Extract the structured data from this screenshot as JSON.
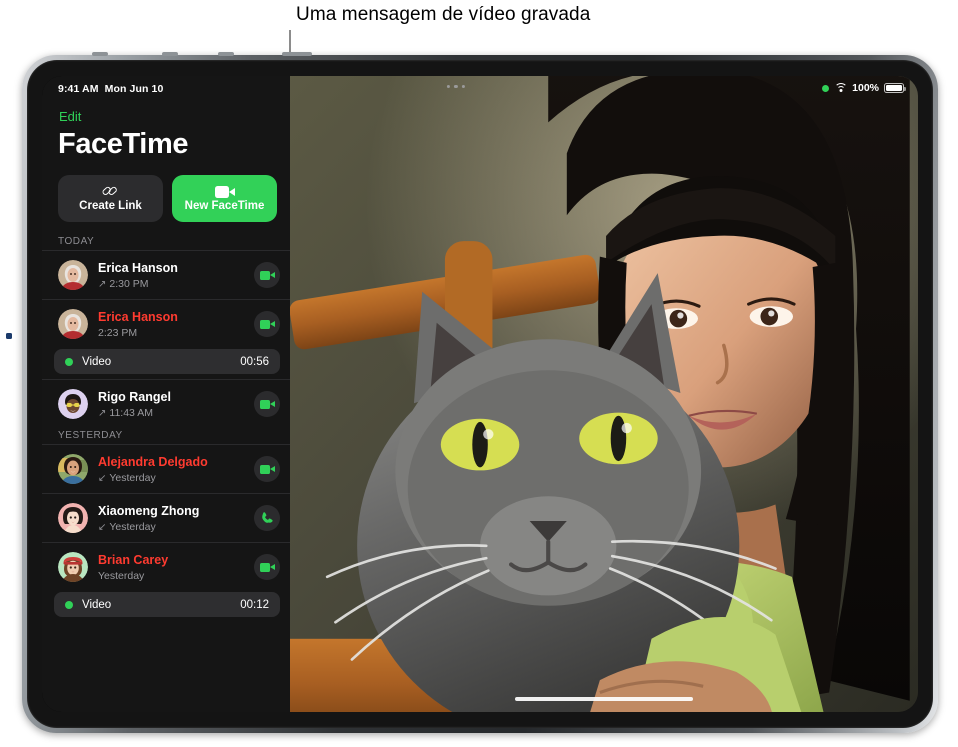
{
  "callout": {
    "text": "Uma mensagem de vídeo gravada"
  },
  "status_bar": {
    "time": "9:41 AM",
    "date": "Mon Jun 10",
    "battery_percent": "100%",
    "recording_dot": "green-dot",
    "wifi_icon": "wifi-icon",
    "battery_icon": "battery-icon"
  },
  "sidebar": {
    "edit_label": "Edit",
    "title": "FaceTime",
    "actions": [
      {
        "label": "Create Link",
        "icon": "link-icon",
        "style": "grey"
      },
      {
        "label": "New FaceTime",
        "icon": "video-camera-icon",
        "style": "green"
      }
    ],
    "sections": [
      {
        "header": "TODAY",
        "rows": [
          {
            "name": "Erica Hanson",
            "time": "2:30 PM",
            "direction": "outgoing",
            "arrow": "↗",
            "missed": false,
            "call_type": "video",
            "avatar": "photo-woman-white-hair",
            "message": null
          },
          {
            "name": "Erica Hanson",
            "time": "2:23 PM",
            "direction": "none",
            "arrow": "",
            "missed": true,
            "call_type": "video",
            "avatar": "photo-woman-white-hair",
            "message": {
              "label": "Video",
              "duration": "00:56"
            }
          },
          {
            "name": "Rigo Rangel",
            "time": "11:43 AM",
            "direction": "outgoing",
            "arrow": "↗",
            "missed": false,
            "call_type": "video",
            "avatar": "memoji-lavender-sunglasses",
            "message": null
          }
        ]
      },
      {
        "header": "YESTERDAY",
        "rows": [
          {
            "name": "Alejandra Delgado",
            "time": "Yesterday",
            "direction": "incoming",
            "arrow": "↙",
            "missed": true,
            "call_type": "video",
            "avatar": "photo-woman-dark-hair",
            "message": null
          },
          {
            "name": "Xiaomeng Zhong",
            "time": "Yesterday",
            "direction": "incoming",
            "arrow": "↙",
            "missed": false,
            "call_type": "audio",
            "avatar": "memoji-pink-bob",
            "message": null
          },
          {
            "name": "Brian Carey",
            "time": "Yesterday",
            "direction": "none",
            "arrow": "",
            "missed": true,
            "call_type": "video",
            "avatar": "memoji-green-red-cap",
            "message": {
              "label": "Video",
              "duration": "00:12"
            }
          }
        ]
      }
    ]
  },
  "video_pane": {
    "description": "Video message showing a woman holding a grey cat",
    "multitask_handle": "multitask-dots",
    "home_indicator": "home-indicator"
  },
  "colors": {
    "accent_green": "#30d158",
    "missed_red": "#ff3b30",
    "sidebar_bg": "#151515",
    "pill_bg": "#2e2e30"
  }
}
